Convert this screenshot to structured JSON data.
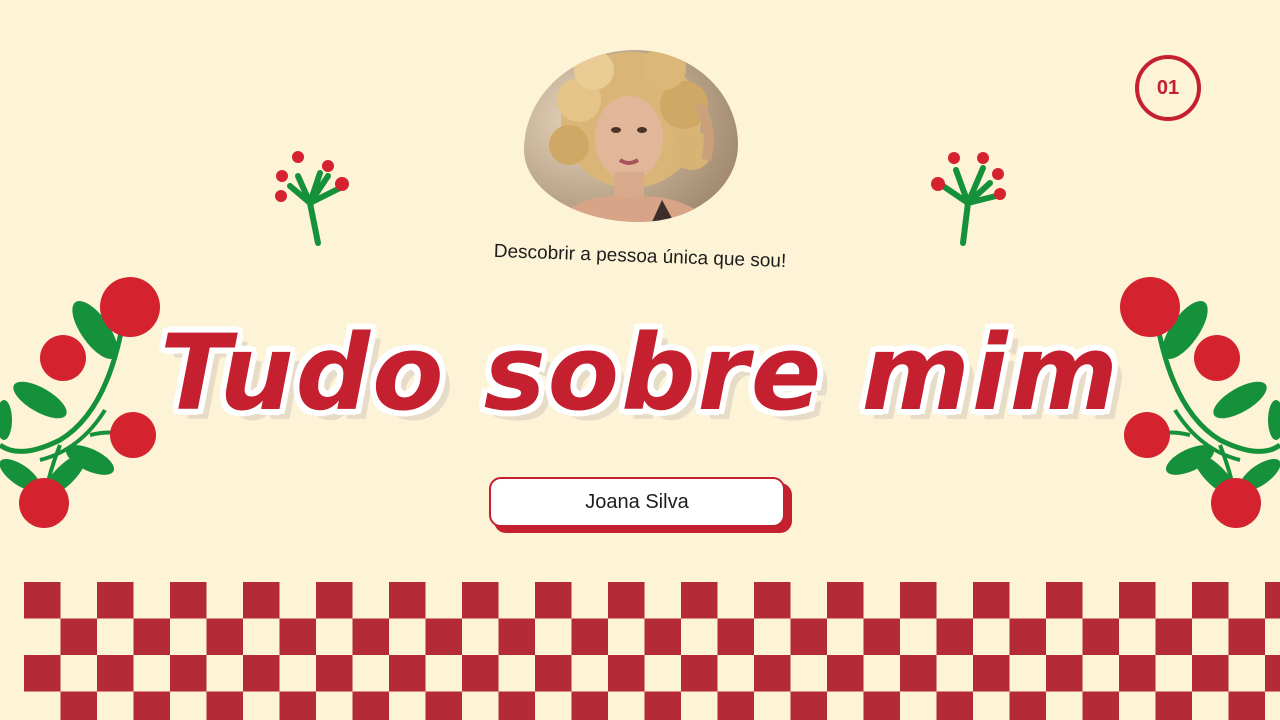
{
  "slide": {
    "page_number": "01",
    "subtitle": "Descobrir a pessoa única que sou!",
    "title": "Tudo sobre mim",
    "name": "Joana Silva"
  },
  "colors": {
    "background": "#fdf3d6",
    "accent_red": "#c4202f",
    "checker_red": "#b42a36",
    "leaf_green": "#16913b"
  },
  "decorations": {
    "photo": "woman-curly-hair-portrait",
    "left_sprig": "berry-sprig-icon",
    "right_sprig": "berry-sprig-icon",
    "left_branch": "berry-branch-icon",
    "right_branch": "berry-branch-icon",
    "bottom_pattern": "checkerboard"
  }
}
